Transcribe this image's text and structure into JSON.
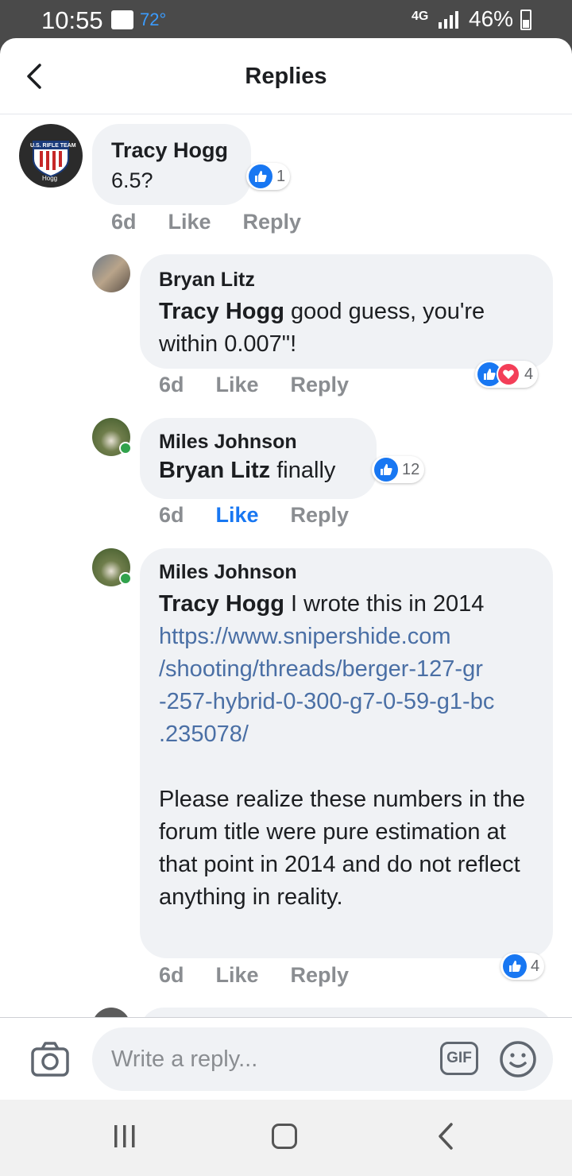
{
  "status": {
    "time": "10:55",
    "temperature": "72°",
    "network": "4G",
    "battery": "46%"
  },
  "header": {
    "title": "Replies",
    "back_icon": "chevron-left-icon"
  },
  "comments": [
    {
      "author": "Tracy Hogg",
      "avatar_badge": "U.S. RIFLE TEAM",
      "avatar_caption": "Hogg",
      "text": "6.5?",
      "age": "6d",
      "like": "Like",
      "reply": "Reply",
      "reactions": {
        "types": [
          "like"
        ],
        "count": "1"
      }
    },
    {
      "author": "Bryan Litz",
      "mention": "Tracy Hogg",
      "text": " good guess, you're within 0.007\"!",
      "age": "6d",
      "like": "Like",
      "reply": "Reply",
      "reactions": {
        "types": [
          "like",
          "love"
        ],
        "count": "4"
      }
    },
    {
      "author": "Miles Johnson",
      "mention": "Bryan Litz",
      "text": " finally",
      "age": "6d",
      "like": "Like",
      "liked": true,
      "reply": "Reply",
      "online": true,
      "reactions": {
        "types": [
          "like"
        ],
        "count": "12"
      }
    },
    {
      "author": "Miles Johnson",
      "mention": "Tracy Hogg",
      "text": " I wrote this in 2014",
      "link": "https://www.snipershide.com/shooting/threads/berger-127-gr-257-hybrid-0-300-g7-0-59-g1-bc.235078/",
      "link_lines": [
        "https://www.snipershide.com",
        "/shooting/threads/berger-127-gr",
        "-257-hybrid-0-300-g7-0-59-g1-bc",
        ".235078/"
      ],
      "text2": "Please realize these numbers in the forum title were pure estimation at that point in 2014 and do not reflect anything in reality.",
      "age": "6d",
      "like": "Like",
      "reply": "Reply",
      "online": true,
      "reactions": {
        "types": [
          "like"
        ],
        "count": "4"
      }
    }
  ],
  "composer": {
    "placeholder": "Write a reply...",
    "gif_label": "GIF",
    "camera_icon": "camera-icon",
    "emoji_icon": "emoji-icon"
  },
  "navbar": {
    "recent_icon": "recent-apps-icon",
    "home_icon": "home-icon",
    "back_icon": "back-icon"
  },
  "colors": {
    "bubble": "#f0f2f5",
    "link": "#4a6fa5",
    "like_blue": "#1877f2",
    "love_red": "#f33e58",
    "online_green": "#31a24c"
  }
}
